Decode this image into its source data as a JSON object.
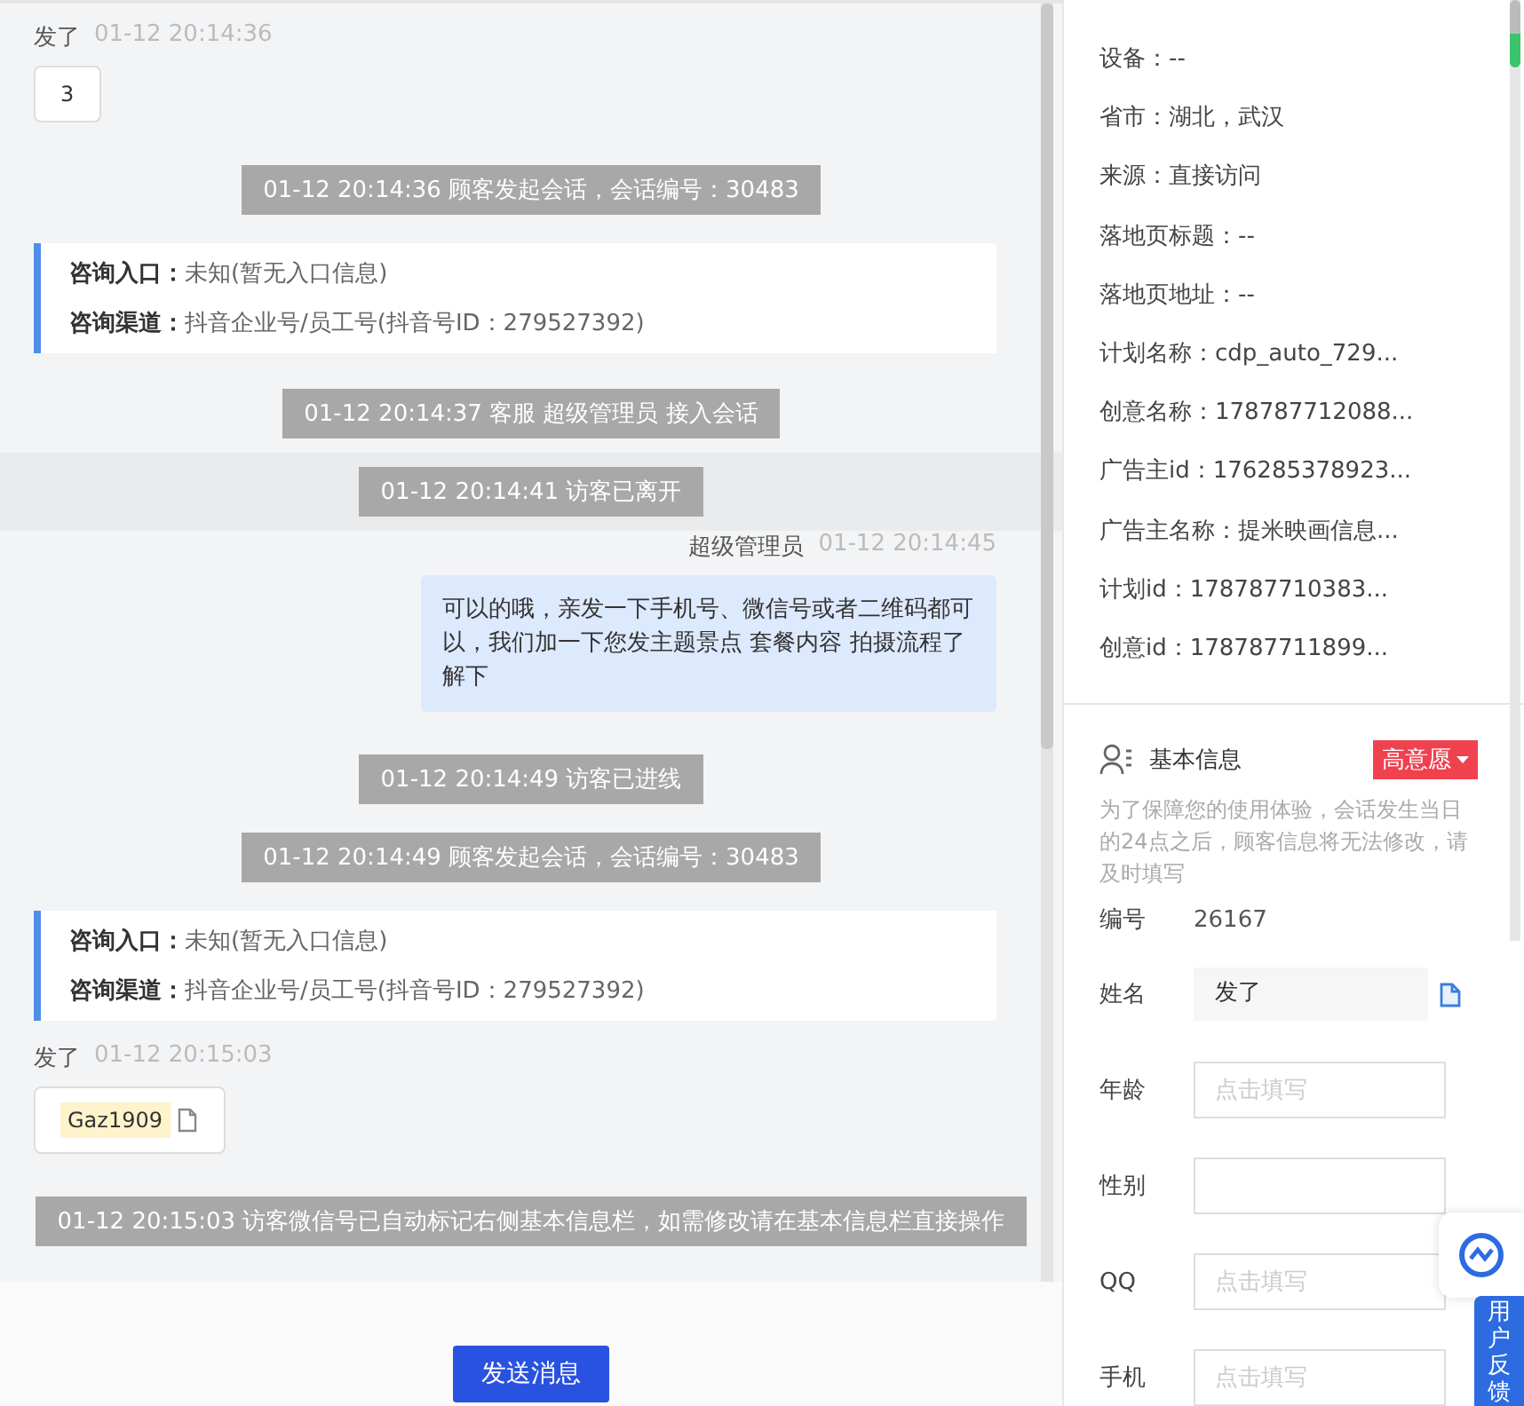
{
  "chat": {
    "messages": [
      {
        "kind": "customer",
        "name": "发了",
        "time": "01-12 20:14:36",
        "text": "3",
        "wechat": false
      },
      {
        "kind": "notice",
        "text": "01-12 20:14:36 顾客发起会话，会话编号：30483"
      },
      {
        "kind": "entry",
        "rows": [
          {
            "label": "咨询入口：",
            "value": "未知(暂无入口信息)"
          },
          {
            "label": "咨询渠道：",
            "value": "抖音企业号/员工号(抖音号ID：279527392)"
          }
        ]
      },
      {
        "kind": "notice",
        "text": "01-12 20:14:37 客服 超级管理员 接入会话"
      },
      {
        "kind": "band_notice",
        "text": "01-12 20:14:41 访客已离开"
      },
      {
        "kind": "agent",
        "name": "超级管理员",
        "time": "01-12 20:14:45",
        "text": "可以的哦，亲发一下手机号、微信号或者二维码都可以，我们加一下您发主题景点 套餐内容 拍摄流程了解下"
      },
      {
        "kind": "notice",
        "text": "01-12 20:14:49 访客已进线"
      },
      {
        "kind": "notice",
        "text": "01-12 20:14:49 顾客发起会话，会话编号：30483"
      },
      {
        "kind": "entry",
        "rows": [
          {
            "label": "咨询入口：",
            "value": "未知(暂无入口信息)"
          },
          {
            "label": "咨询渠道：",
            "value": "抖音企业号/员工号(抖音号ID：279527392)"
          }
        ]
      },
      {
        "kind": "customer",
        "name": "发了",
        "time": "01-12 20:15:03",
        "text": "Gaz1909",
        "wechat": true
      },
      {
        "kind": "notice",
        "text": "01-12 20:15:03 访客微信号已自动标记右侧基本信息栏，如需修改请在基本信息栏直接操作"
      }
    ],
    "send_button": "发送消息"
  },
  "source_info": [
    "设备：--",
    "省市：湖北，武汉",
    "来源：直接访问",
    "落地页标题：--",
    "落地页地址：--",
    "计划名称：cdp_auto_729...",
    "创意名称：178787712088...",
    "广告主id：176285378923...",
    "广告主名称：提米映画信息...",
    "计划id：178787710383...",
    "创意id：178787711899..."
  ],
  "basic_info": {
    "title": "基本信息",
    "intent_tag": "高意愿",
    "notice": "为了保障您的使用体验，会话发生当日的24点之后，顾客信息将无法修改，请及时填写",
    "fields": [
      {
        "kind": "text",
        "label": "编号",
        "value": "26167"
      },
      {
        "kind": "copy",
        "label": "姓名",
        "value": "发了"
      },
      {
        "kind": "input",
        "label": "年龄",
        "placeholder": "点击填写"
      },
      {
        "kind": "select",
        "label": "性别"
      },
      {
        "kind": "input",
        "label": "QQ",
        "placeholder": "点击填写"
      },
      {
        "kind": "input",
        "label": "手机",
        "placeholder": "点击填写"
      }
    ]
  },
  "feedback_tab": "用户反馈"
}
